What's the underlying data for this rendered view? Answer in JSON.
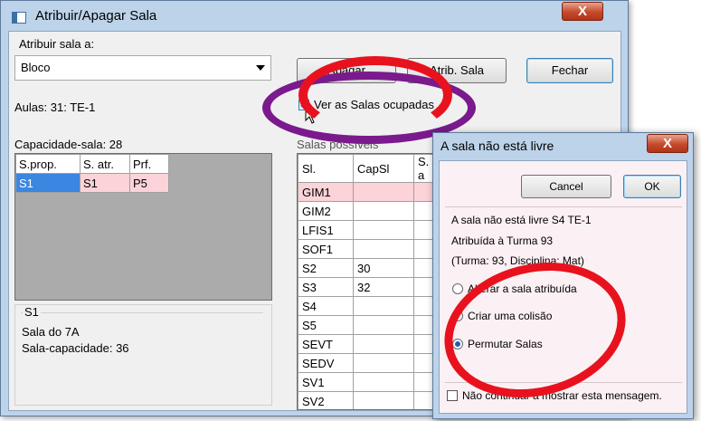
{
  "main_window": {
    "title": "Atribuir/Apagar Sala",
    "atribuir_label": "Atribuir sala a:",
    "combo_value": "Bloco",
    "aulas": "Aulas: 31: TE-1",
    "buttons": {
      "apagar": "Apagar",
      "atrib": "Atrib. Sala",
      "fechar": "Fechar"
    },
    "ver_ocupadas": "Ver as Salas ocupadas",
    "capacidade": "Capacidade-sala: 28",
    "left_grid": {
      "headers": [
        "S.prop.",
        "S. atr.",
        "Prf."
      ],
      "row": [
        "S1",
        "S1",
        "P5"
      ]
    },
    "info": {
      "title": "S1",
      "line1": "Sala do 7A",
      "line2": "Sala-capacidade: 36"
    },
    "salas_label": "Salas possíveis",
    "right_grid": {
      "headers": [
        "Sl.",
        "CapSl",
        "S. a"
      ],
      "rows": [
        [
          "GIM1",
          "",
          ""
        ],
        [
          "GIM2",
          "",
          ""
        ],
        [
          "LFIS1",
          "",
          ""
        ],
        [
          "SOF1",
          "",
          ""
        ],
        [
          "S2",
          "30",
          ""
        ],
        [
          "S3",
          "32",
          ""
        ],
        [
          "S4",
          "",
          ""
        ],
        [
          "S5",
          "",
          ""
        ],
        [
          "SEVT",
          "",
          ""
        ],
        [
          "SEDV",
          "",
          ""
        ],
        [
          "SV1",
          "",
          ""
        ],
        [
          "SV2",
          "",
          ""
        ]
      ]
    }
  },
  "dialog": {
    "title": "A sala não está livre",
    "cancel": "Cancel",
    "ok": "OK",
    "msg1": "A sala não está livre  S4  TE-1",
    "msg2": "Atribuída à Turma 93",
    "msg3": "(Turma: 93, Disciplina: Mat)",
    "options": [
      "Alterar a sala atribuída",
      "Criar uma colisão",
      "Permutar Salas"
    ],
    "selected_index": 2,
    "dont_show": "Não continuar a mostrar esta mensagem."
  },
  "annotation_colors": {
    "purple_ellipse": "#7a1a8c",
    "red_ellipse": "#e8121e"
  }
}
